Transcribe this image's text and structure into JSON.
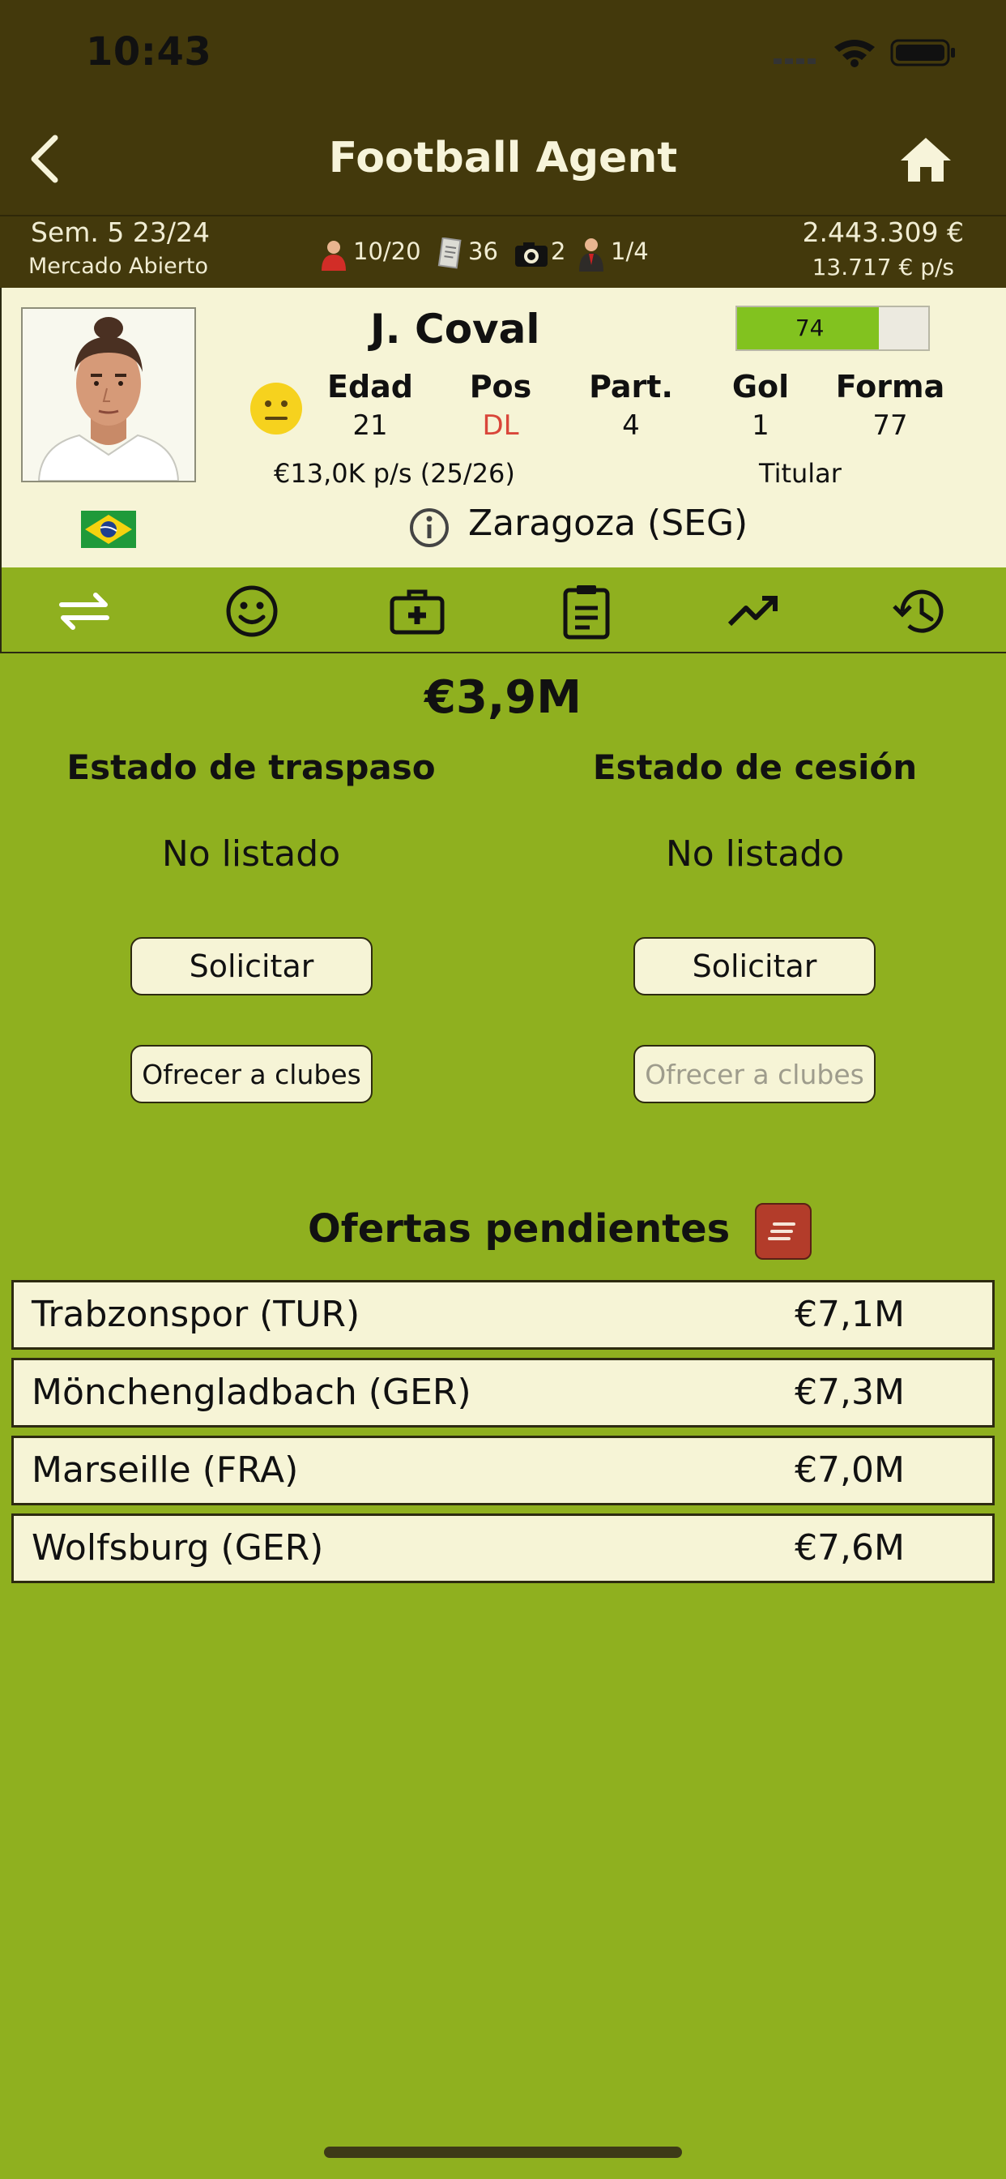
{
  "status_bar": {
    "time": "10:43"
  },
  "nav": {
    "title": "Football Agent"
  },
  "info_bar": {
    "week": "Sem. 5 23/24",
    "market": "Mercado Abierto",
    "clients": "10/20",
    "reports": "36",
    "scouts": "2",
    "staff": "1/4",
    "balance": "2.443.309 €",
    "income": "13.717 € p/s"
  },
  "player": {
    "name": "J. Coval",
    "rating": "74",
    "rating_fraction": 0.74,
    "stats": [
      {
        "label": "Edad",
        "value": "21"
      },
      {
        "label": "Pos",
        "value": "DL"
      },
      {
        "label": "Part.",
        "value": "4"
      },
      {
        "label": "Gol",
        "value": "1"
      },
      {
        "label": "Forma",
        "value": "77"
      }
    ],
    "salary": "€13,0K p/s (25/26)",
    "role": "Titular",
    "club": "Zaragoza (SEG)",
    "colors": {
      "position": "#d9463a",
      "rating": "#82c21f"
    }
  },
  "transfer": {
    "value": "€3,9M",
    "transfer_title": "Estado de traspaso",
    "loan_title": "Estado de cesión",
    "transfer_status": "No listado",
    "loan_status": "No listado",
    "request_label": "Solicitar",
    "offer_label": "Ofrecer a clubes"
  },
  "offers": {
    "title": "Ofertas pendientes",
    "items": [
      {
        "club": "Trabzonspor (TUR)",
        "amount": "€7,1M"
      },
      {
        "club": "Mönchengladbach (GER)",
        "amount": "€7,3M"
      },
      {
        "club": "Marseille (FRA)",
        "amount": "€7,0M"
      },
      {
        "club": "Wolfsburg (GER)",
        "amount": "€7,6M"
      }
    ]
  }
}
